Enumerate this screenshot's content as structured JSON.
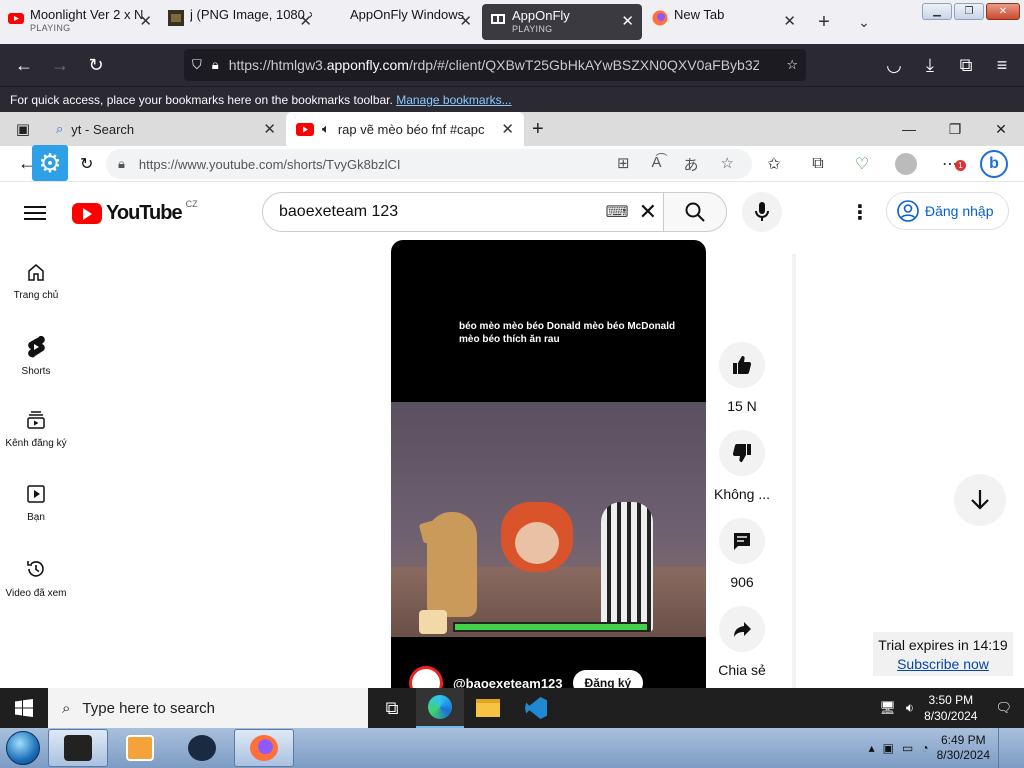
{
  "outer_browser": {
    "tabs": [
      {
        "title": "Moonlight Ver 2 x N",
        "status": "PLAYING",
        "icon": "youtube-icon"
      },
      {
        "title": "j (PNG Image, 1080 ×",
        "status": "",
        "icon": "image-icon"
      },
      {
        "title": "AppOnFly Windows",
        "status": "",
        "icon": ""
      },
      {
        "title": "AppOnFly",
        "status": "PLAYING",
        "icon": "apponfly-icon",
        "active": true
      },
      {
        "title": "New Tab",
        "status": "",
        "icon": "firefox-icon"
      }
    ],
    "url_prefix": "https://htmlgw3.",
    "url_domain": "apponfly.com",
    "url_rest": "/rdp/#/client/QXBwT25GbHkAYwBSZXN0QXV0aFByb3Z",
    "bookmarks_text": "For quick access, place your bookmarks here on the bookmarks toolbar.",
    "bookmarks_link": "Manage bookmarks..."
  },
  "inner_browser": {
    "tabs": [
      {
        "title": "yt - Search",
        "icon": "search-icon"
      },
      {
        "title": "rap vẽ mèo béo fnf #capcut",
        "icon": "youtube-icon",
        "active": true
      }
    ],
    "url": "https://www.youtube.com/shorts/TvyGk8bzlCI"
  },
  "youtube": {
    "logo_text": "YouTube",
    "country": "CZ",
    "search_value": "baoexeteam 123",
    "sign_in": "Đăng nhập",
    "sidebar": [
      {
        "label": "Trang chủ",
        "icon": "home-icon"
      },
      {
        "label": "Shorts",
        "icon": "shorts-icon"
      },
      {
        "label": "Kênh đăng ký",
        "icon": "subscriptions-icon"
      },
      {
        "label": "Bạn",
        "icon": "you-icon"
      },
      {
        "label": "Video đã xem",
        "icon": "history-icon"
      }
    ],
    "short": {
      "caption": "béo mèo mèo béo Donald mèo béo McDonald mèo béo thích ăn rau",
      "channel": "@baoexeteam123",
      "subscribe": "Đăng ký"
    },
    "actions": [
      {
        "label": "15 N",
        "icon": "like-icon"
      },
      {
        "label": "Không ...",
        "icon": "dislike-icon"
      },
      {
        "label": "906",
        "icon": "comment-icon"
      },
      {
        "label": "Chia sẻ",
        "icon": "share-icon"
      }
    ]
  },
  "trial": {
    "text": "Trial expires in 14:19",
    "link": "Subscribe now"
  },
  "win10_taskbar": {
    "search_placeholder": "Type here to search",
    "time": "3:50 PM",
    "date": "8/30/2024"
  },
  "win7_taskbar": {
    "time": "6:49 PM",
    "date": "8/30/2024"
  }
}
